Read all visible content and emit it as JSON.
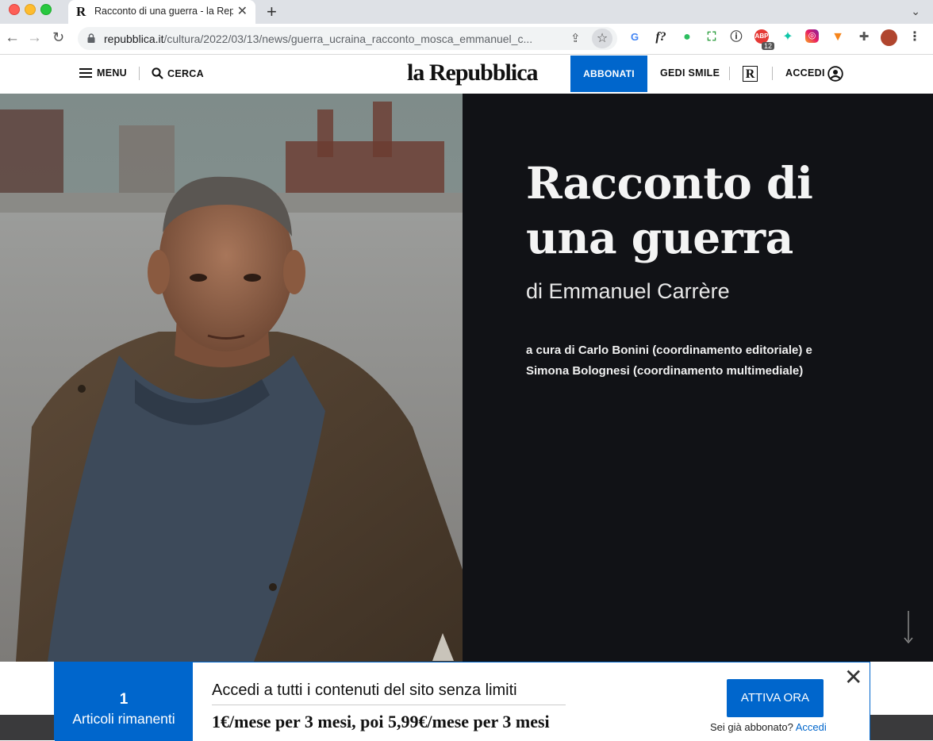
{
  "browser": {
    "tab_title": "Racconto di una guerra - la Repubblica",
    "tab_favicon": "R",
    "url_domain": "repubblica.it",
    "url_path": "/cultura/2022/03/13/news/guerra_ucraina_racconto_mosca_emmanuel_c...",
    "extension_badge": "12"
  },
  "header": {
    "menu_label": "MENU",
    "search_label": "CERCA",
    "logo": "la Repubblica",
    "subscribe_label": "ABBONATI",
    "gedi_label": "GEDI SMILE",
    "r_badge": "R",
    "login_label": "ACCEDI"
  },
  "hero": {
    "title": "Racconto di una guerra",
    "author": "di Emmanuel Carrère",
    "credits_line1": "a cura di Carlo Bonini (coordinamento editoriale) e",
    "credits_line2": "Simona Bolognesi (coordinamento multimediale)"
  },
  "paywall": {
    "count": "1",
    "count_label": "Articoli rimanenti",
    "headline": "Accedi a tutti i contenuti del sito senza limiti",
    "price": "1€/mese per 3 mesi, poi 5,99€/mese per 3 mesi",
    "cta": "ATTIVA ORA",
    "subscriber_text": "Sei già abbonato?",
    "subscriber_link": "Accedi"
  },
  "colors": {
    "brand_blue": "#0066cc",
    "hero_dark": "#111216"
  }
}
